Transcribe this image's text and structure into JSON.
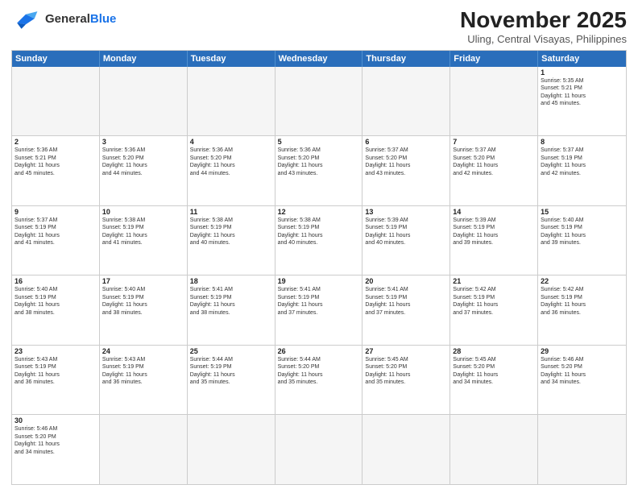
{
  "header": {
    "logo_general": "General",
    "logo_blue": "Blue",
    "month": "November 2025",
    "location": "Uling, Central Visayas, Philippines"
  },
  "weekdays": [
    "Sunday",
    "Monday",
    "Tuesday",
    "Wednesday",
    "Thursday",
    "Friday",
    "Saturday"
  ],
  "weeks": [
    [
      {
        "day": "",
        "empty": true,
        "text": ""
      },
      {
        "day": "",
        "empty": true,
        "text": ""
      },
      {
        "day": "",
        "empty": true,
        "text": ""
      },
      {
        "day": "",
        "empty": true,
        "text": ""
      },
      {
        "day": "",
        "empty": true,
        "text": ""
      },
      {
        "day": "",
        "empty": true,
        "text": ""
      },
      {
        "day": "1",
        "empty": false,
        "text": "Sunrise: 5:35 AM\nSunset: 5:21 PM\nDaylight: 11 hours\nand 45 minutes."
      }
    ],
    [
      {
        "day": "2",
        "empty": false,
        "text": "Sunrise: 5:36 AM\nSunset: 5:21 PM\nDaylight: 11 hours\nand 45 minutes."
      },
      {
        "day": "3",
        "empty": false,
        "text": "Sunrise: 5:36 AM\nSunset: 5:20 PM\nDaylight: 11 hours\nand 44 minutes."
      },
      {
        "day": "4",
        "empty": false,
        "text": "Sunrise: 5:36 AM\nSunset: 5:20 PM\nDaylight: 11 hours\nand 44 minutes."
      },
      {
        "day": "5",
        "empty": false,
        "text": "Sunrise: 5:36 AM\nSunset: 5:20 PM\nDaylight: 11 hours\nand 43 minutes."
      },
      {
        "day": "6",
        "empty": false,
        "text": "Sunrise: 5:37 AM\nSunset: 5:20 PM\nDaylight: 11 hours\nand 43 minutes."
      },
      {
        "day": "7",
        "empty": false,
        "text": "Sunrise: 5:37 AM\nSunset: 5:20 PM\nDaylight: 11 hours\nand 42 minutes."
      },
      {
        "day": "8",
        "empty": false,
        "text": "Sunrise: 5:37 AM\nSunset: 5:19 PM\nDaylight: 11 hours\nand 42 minutes."
      }
    ],
    [
      {
        "day": "9",
        "empty": false,
        "text": "Sunrise: 5:37 AM\nSunset: 5:19 PM\nDaylight: 11 hours\nand 41 minutes."
      },
      {
        "day": "10",
        "empty": false,
        "text": "Sunrise: 5:38 AM\nSunset: 5:19 PM\nDaylight: 11 hours\nand 41 minutes."
      },
      {
        "day": "11",
        "empty": false,
        "text": "Sunrise: 5:38 AM\nSunset: 5:19 PM\nDaylight: 11 hours\nand 40 minutes."
      },
      {
        "day": "12",
        "empty": false,
        "text": "Sunrise: 5:38 AM\nSunset: 5:19 PM\nDaylight: 11 hours\nand 40 minutes."
      },
      {
        "day": "13",
        "empty": false,
        "text": "Sunrise: 5:39 AM\nSunset: 5:19 PM\nDaylight: 11 hours\nand 40 minutes."
      },
      {
        "day": "14",
        "empty": false,
        "text": "Sunrise: 5:39 AM\nSunset: 5:19 PM\nDaylight: 11 hours\nand 39 minutes."
      },
      {
        "day": "15",
        "empty": false,
        "text": "Sunrise: 5:40 AM\nSunset: 5:19 PM\nDaylight: 11 hours\nand 39 minutes."
      }
    ],
    [
      {
        "day": "16",
        "empty": false,
        "text": "Sunrise: 5:40 AM\nSunset: 5:19 PM\nDaylight: 11 hours\nand 38 minutes."
      },
      {
        "day": "17",
        "empty": false,
        "text": "Sunrise: 5:40 AM\nSunset: 5:19 PM\nDaylight: 11 hours\nand 38 minutes."
      },
      {
        "day": "18",
        "empty": false,
        "text": "Sunrise: 5:41 AM\nSunset: 5:19 PM\nDaylight: 11 hours\nand 38 minutes."
      },
      {
        "day": "19",
        "empty": false,
        "text": "Sunrise: 5:41 AM\nSunset: 5:19 PM\nDaylight: 11 hours\nand 37 minutes."
      },
      {
        "day": "20",
        "empty": false,
        "text": "Sunrise: 5:41 AM\nSunset: 5:19 PM\nDaylight: 11 hours\nand 37 minutes."
      },
      {
        "day": "21",
        "empty": false,
        "text": "Sunrise: 5:42 AM\nSunset: 5:19 PM\nDaylight: 11 hours\nand 37 minutes."
      },
      {
        "day": "22",
        "empty": false,
        "text": "Sunrise: 5:42 AM\nSunset: 5:19 PM\nDaylight: 11 hours\nand 36 minutes."
      }
    ],
    [
      {
        "day": "23",
        "empty": false,
        "text": "Sunrise: 5:43 AM\nSunset: 5:19 PM\nDaylight: 11 hours\nand 36 minutes."
      },
      {
        "day": "24",
        "empty": false,
        "text": "Sunrise: 5:43 AM\nSunset: 5:19 PM\nDaylight: 11 hours\nand 36 minutes."
      },
      {
        "day": "25",
        "empty": false,
        "text": "Sunrise: 5:44 AM\nSunset: 5:19 PM\nDaylight: 11 hours\nand 35 minutes."
      },
      {
        "day": "26",
        "empty": false,
        "text": "Sunrise: 5:44 AM\nSunset: 5:20 PM\nDaylight: 11 hours\nand 35 minutes."
      },
      {
        "day": "27",
        "empty": false,
        "text": "Sunrise: 5:45 AM\nSunset: 5:20 PM\nDaylight: 11 hours\nand 35 minutes."
      },
      {
        "day": "28",
        "empty": false,
        "text": "Sunrise: 5:45 AM\nSunset: 5:20 PM\nDaylight: 11 hours\nand 34 minutes."
      },
      {
        "day": "29",
        "empty": false,
        "text": "Sunrise: 5:46 AM\nSunset: 5:20 PM\nDaylight: 11 hours\nand 34 minutes."
      }
    ],
    [
      {
        "day": "30",
        "empty": false,
        "text": "Sunrise: 5:46 AM\nSunset: 5:20 PM\nDaylight: 11 hours\nand 34 minutes."
      },
      {
        "day": "",
        "empty": true,
        "text": ""
      },
      {
        "day": "",
        "empty": true,
        "text": ""
      },
      {
        "day": "",
        "empty": true,
        "text": ""
      },
      {
        "day": "",
        "empty": true,
        "text": ""
      },
      {
        "day": "",
        "empty": true,
        "text": ""
      },
      {
        "day": "",
        "empty": true,
        "text": ""
      }
    ]
  ]
}
